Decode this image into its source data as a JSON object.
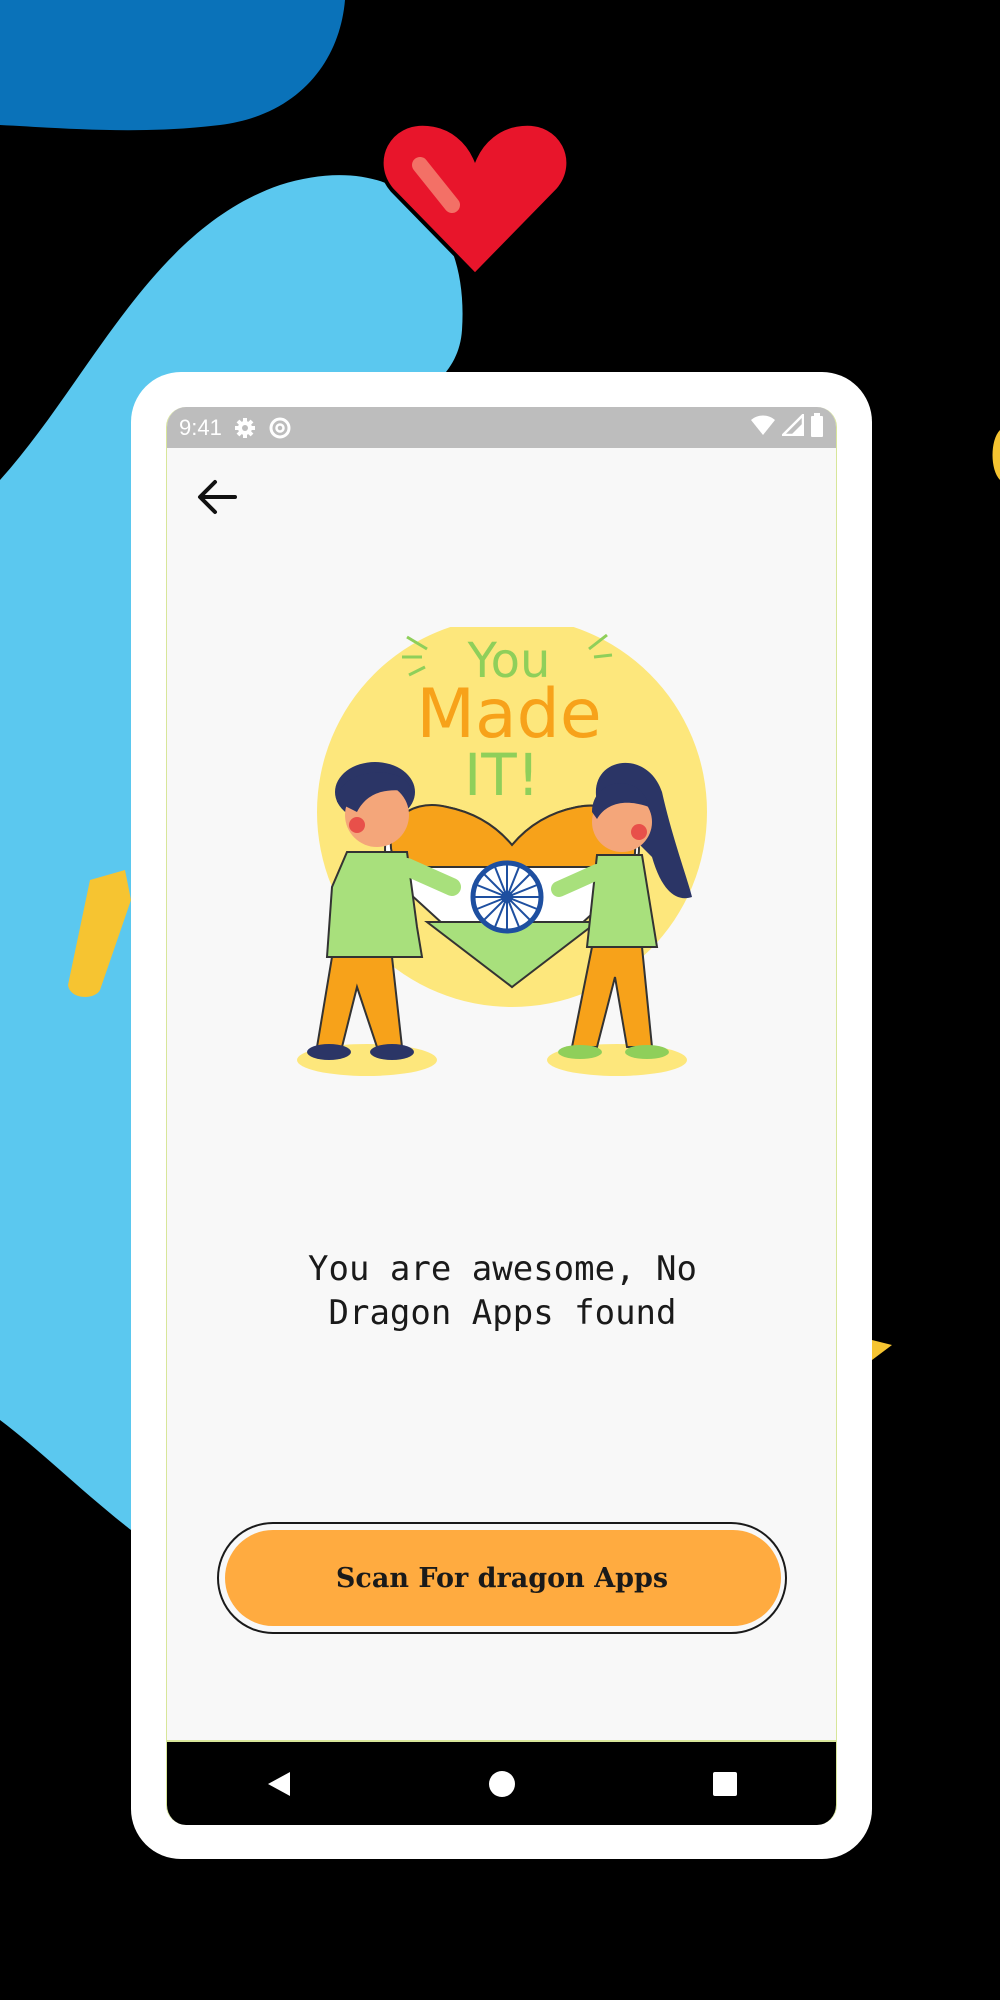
{
  "status_bar": {
    "time": "9:41",
    "icons": [
      "gear-icon",
      "at-sign-icon",
      "wifi-icon",
      "signal-icon",
      "battery-icon"
    ]
  },
  "toolbar": {
    "back_icon": "arrow-left-icon"
  },
  "illustration": {
    "line1": "You",
    "line2": "Made",
    "line3": "IT!"
  },
  "message": {
    "line1": "You are awesome, No",
    "line2": "Dragon Apps found"
  },
  "scan_button": {
    "label": "Scan For dragon Apps"
  },
  "nav_bar": {
    "icons": [
      "back-triangle-icon",
      "home-circle-icon",
      "recents-square-icon"
    ]
  },
  "colors": {
    "accent": "#ffab40",
    "background": "#f8f8f8",
    "heart": "#e8152b",
    "blob_light_blue": "#5bc8ef",
    "blob_dark_blue": "#0a72b9"
  }
}
